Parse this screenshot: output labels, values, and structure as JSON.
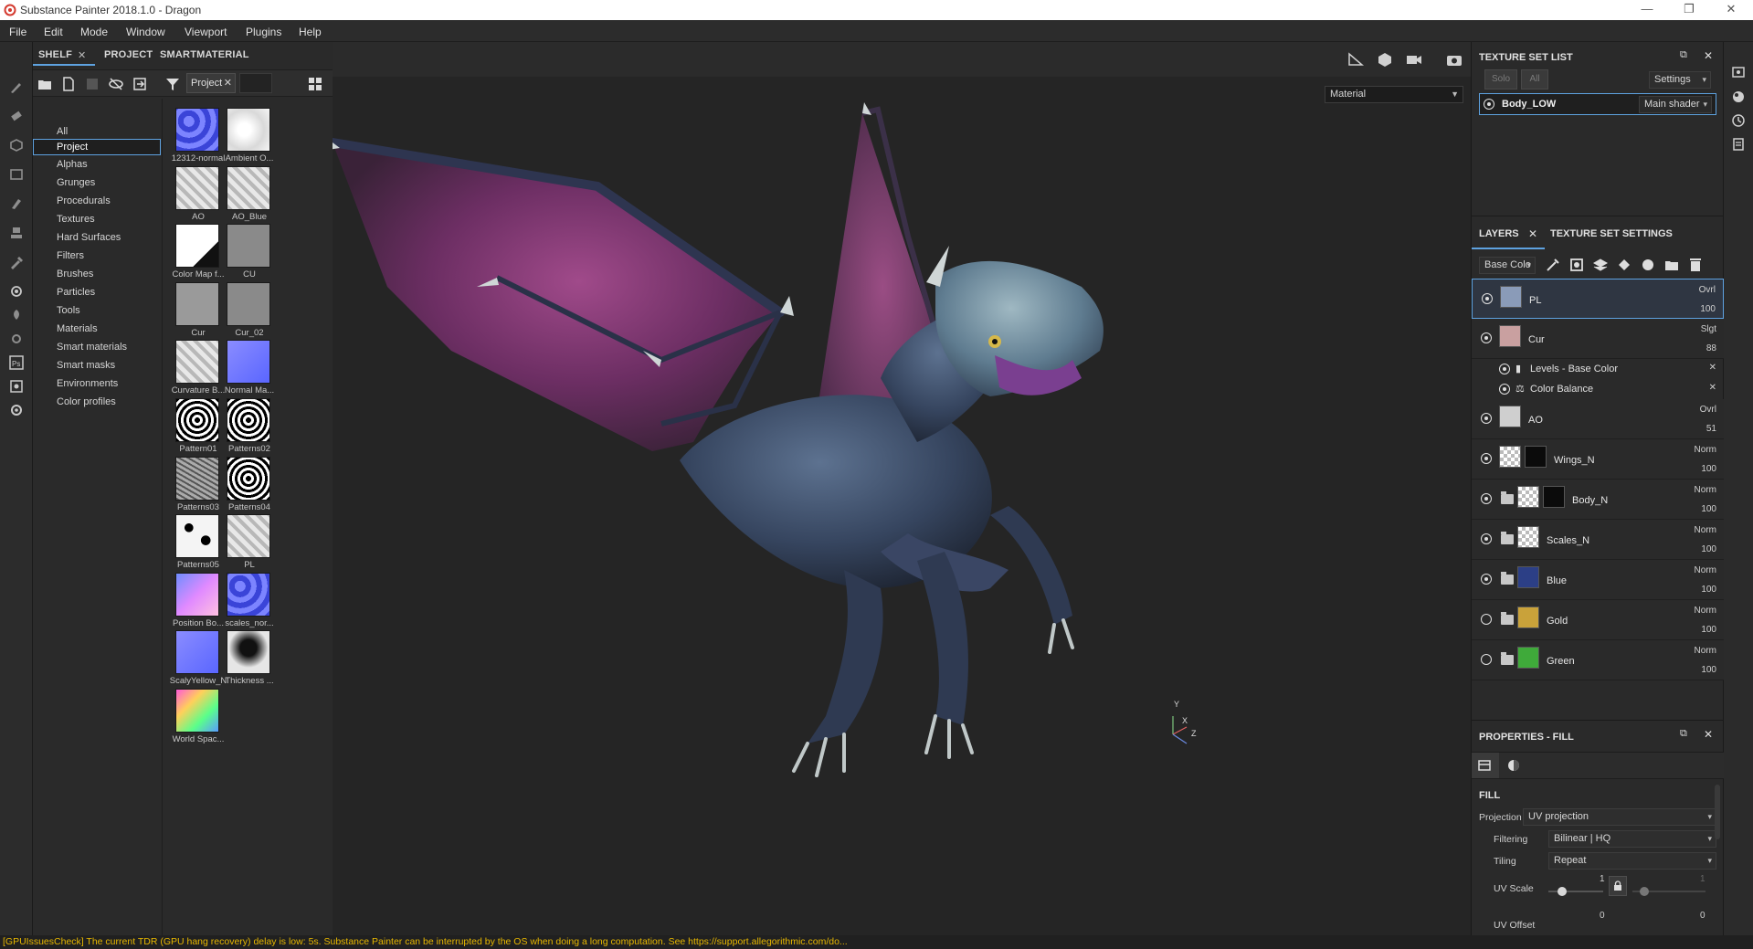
{
  "window": {
    "title": "Substance Painter 2018.1.0 - Dragon",
    "minimize": "—",
    "restore": "❐",
    "close": "✕"
  },
  "menu": [
    "File",
    "Edit",
    "Mode",
    "Window",
    "Viewport",
    "Plugins",
    "Help"
  ],
  "shelf": {
    "tabs": [
      "SHELF",
      "PROJECT",
      "SMARTMATERIAL"
    ],
    "filter_chip": "Project",
    "categories": [
      "All",
      "Project",
      "Alphas",
      "Grunges",
      "Procedurals",
      "Textures",
      "Hard Surfaces",
      "Filters",
      "Brushes",
      "Particles",
      "Tools",
      "Materials",
      "Smart materials",
      "Smart masks",
      "Environments",
      "Color profiles"
    ],
    "selected_category": "Project",
    "thumbnails": [
      {
        "label": "12312-normal",
        "style": "normal-scales"
      },
      {
        "label": "Ambient O...",
        "style": "white-cloud"
      },
      {
        "label": "AO",
        "style": "grey-map"
      },
      {
        "label": "AO_Blue",
        "style": "grey-map"
      },
      {
        "label": "Color Map f...",
        "style": "white-black"
      },
      {
        "label": "CU",
        "style": "flat-grey"
      },
      {
        "label": "Cur",
        "style": "flat-grey2"
      },
      {
        "label": "Cur_02",
        "style": "flat-grey"
      },
      {
        "label": "Curvature B...",
        "style": "grey-map"
      },
      {
        "label": "Normal Ma...",
        "style": "normal-flat"
      },
      {
        "label": "Pattern01",
        "style": "pattern"
      },
      {
        "label": "Patterns02",
        "style": "pattern"
      },
      {
        "label": "Patterns03",
        "style": "noise"
      },
      {
        "label": "Patterns04",
        "style": "pattern"
      },
      {
        "label": "Patterns05",
        "style": "spots"
      },
      {
        "label": "PL",
        "style": "grey-map"
      },
      {
        "label": "Position Bo...",
        "style": "position"
      },
      {
        "label": "scales_nor...",
        "style": "normal-scales"
      },
      {
        "label": "ScalyYellow_N",
        "style": "normal-flat"
      },
      {
        "label": "Thickness ...",
        "style": "thickness"
      },
      {
        "label": "World Spac...",
        "style": "world"
      }
    ]
  },
  "viewport": {
    "mode_select": "Material",
    "axis_y": "Y",
    "axis_x": "X",
    "axis_z": "Z"
  },
  "texture_set_list": {
    "title": "TEXTURE SET LIST",
    "solo": "Solo",
    "all": "All",
    "settings": "Settings",
    "set_name": "Body_LOW",
    "shader": "Main shader"
  },
  "layers": {
    "tab_layers": "LAYERS",
    "tab_settings": "TEXTURE SET SETTINGS",
    "channel": "Base Colo",
    "items": [
      {
        "name": "PL",
        "blend": "Ovrl",
        "opacity": "100",
        "visible": true,
        "folder": false,
        "thumb": "#8a9bb8"
      },
      {
        "name": "Cur",
        "blend": "Slgt",
        "opacity": "88",
        "visible": true,
        "folder": false,
        "thumb": "#c9a0a0"
      },
      {
        "name": "AO",
        "blend": "Ovrl",
        "opacity": "51",
        "visible": true,
        "folder": false,
        "thumb": "#cfcfcf"
      },
      {
        "name": "Wings_N",
        "blend": "Norm",
        "opacity": "100",
        "visible": true,
        "folder": false,
        "thumb": "checker"
      },
      {
        "name": "Body_N",
        "blend": "Norm",
        "opacity": "100",
        "visible": true,
        "folder": true,
        "thumb": "checker"
      },
      {
        "name": "Scales_N",
        "blend": "Norm",
        "opacity": "100",
        "visible": true,
        "folder": true,
        "thumb": "checker"
      },
      {
        "name": "Blue",
        "blend": "Norm",
        "opacity": "100",
        "visible": true,
        "folder": true,
        "thumb": "#2c3f86"
      },
      {
        "name": "Gold",
        "blend": "Norm",
        "opacity": "100",
        "visible": false,
        "folder": true,
        "thumb": "#c9a23a"
      },
      {
        "name": "Green",
        "blend": "Norm",
        "opacity": "100",
        "visible": false,
        "folder": true,
        "thumb": "#3faa3a"
      }
    ],
    "effects": [
      "Levels - Base Color",
      "Color Balance"
    ]
  },
  "properties": {
    "title": "PROPERTIES - FILL",
    "section": "FILL",
    "projection_label": "Projection",
    "projection_value": "UV projection",
    "filtering_label": "Filtering",
    "filtering_value": "Bilinear | HQ",
    "tiling_label": "Tiling",
    "tiling_value": "Repeat",
    "uvscale_label": "UV Scale",
    "uvscale_value": "1",
    "uvscale_value2": "1",
    "uvoffset_label": "UV Offset",
    "uvoffset_value": "0",
    "uvoffset_value2": "0"
  },
  "status": {
    "message": "[GPUIssuesCheck] The current TDR (GPU hang recovery) delay is low: 5s. Substance Painter can be interrupted by the OS when doing a long computation. See https://support.allegorithmic.com/do..."
  },
  "colors": {
    "accent": "#5ea2e0",
    "status_text": "#e8b800",
    "panel_bg": "#2a2a2a"
  }
}
